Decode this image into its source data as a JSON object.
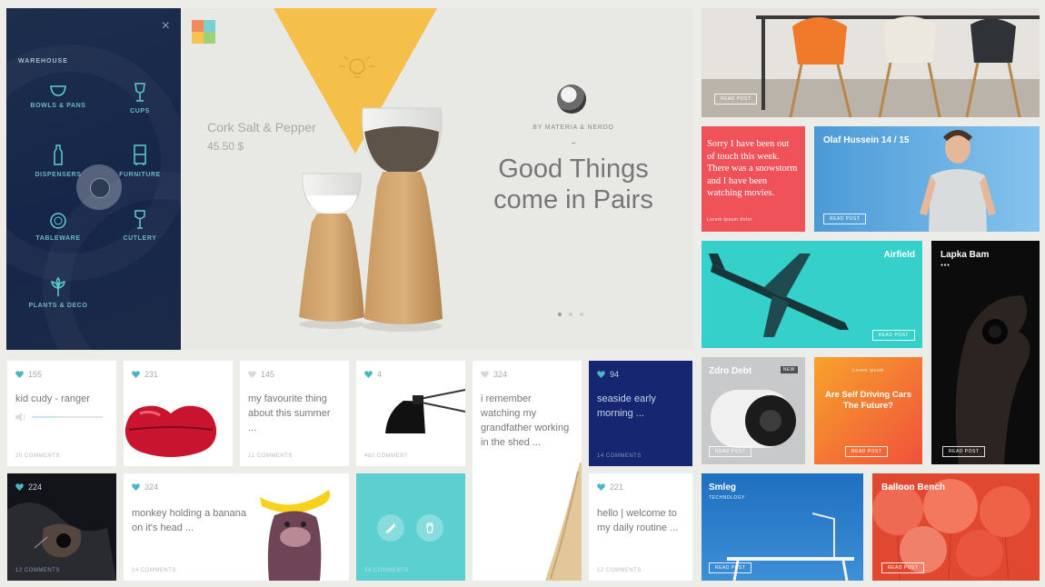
{
  "colors": {
    "accent_teal": "#5ccfd1",
    "heart_teal": "#4ab8c3",
    "sidebar_navy": "#1b2a47",
    "hero_yellow": "#f5c04a",
    "coral": "#f0525a",
    "orange": "#f36b3a",
    "blue": "#2f7fc6"
  },
  "sidebar": {
    "close_glyph": "×",
    "title": "WAREHOUSE",
    "items": [
      {
        "label": "BOWLS & PANS",
        "icon": "bowl-icon"
      },
      {
        "label": "CUPS",
        "icon": "cup-icon"
      },
      {
        "label": "DISPENSERS",
        "icon": "dispenser-icon"
      },
      {
        "label": "FURNITURE",
        "icon": "furniture-icon"
      },
      {
        "label": "TABLEWARE",
        "icon": "tableware-icon"
      },
      {
        "label": "CUTLERY",
        "icon": "cutlery-icon"
      },
      {
        "label": "PLANTS & DECO",
        "icon": "plant-icon"
      }
    ]
  },
  "hero": {
    "product_name": "Cork Salt & Pepper",
    "price": "45.50 $",
    "byline": "BY MATERIA & NERDO",
    "headline": "Good Things come in Pairs",
    "slides": 3,
    "active_slide": 1
  },
  "feed": [
    {
      "likes": "155",
      "text": "kid cudy - ranger",
      "comments": "20 COMMENTS"
    },
    {
      "likes": "231"
    },
    {
      "likes": "145",
      "text": "my favourite thing about this summer ...",
      "comments": "12 COMMENTS"
    },
    {
      "likes": "4",
      "comments": "460 COMMENT"
    },
    {
      "likes": "324",
      "text": "i remember watching my grandfather working in the shed ..."
    },
    {
      "likes": "94",
      "text": "seaside early morning ...",
      "comments": "14 COMMENTS"
    },
    {
      "likes": "224",
      "comments": "12 COMMENTS"
    },
    {
      "likes": "324",
      "text": "monkey holding a banana on it's head ...",
      "comments": "14 COMMENTS"
    },
    {
      "comments": "34 COMMENTS"
    },
    {
      "likes": "221",
      "text": "hello | welcome to my daily routine ...",
      "comments": "12 COMMENTS"
    }
  ],
  "tiles": {
    "chairs": {
      "button": "READ POST"
    },
    "quote": {
      "text": "Sorry I have been out of touch this week. There was a snowstorm and I have been watching movies.",
      "sub": "Lorem ipsum dolor"
    },
    "olaf": {
      "title": "Olaf Hussein 14 / 15",
      "button": "READ POST"
    },
    "airfield": {
      "title": "Airfield",
      "button": "READ POST"
    },
    "lapka": {
      "title": "Lapka Bam",
      "sub": "●●●",
      "button": "READ POST"
    },
    "zdrodebt": {
      "title": "Zdro Debt",
      "badge": "NEW",
      "button": "READ POST"
    },
    "selfdriving": {
      "kicker": "Lorem ipsum",
      "title": "Are Self Driving Cars The Future?",
      "button": "READ POST"
    },
    "smleg": {
      "title": "Smleg",
      "sub": "TECHNOLOGY",
      "button": "READ POST"
    },
    "balloon": {
      "title": "Balloon Bench",
      "button": "READ POST"
    }
  }
}
